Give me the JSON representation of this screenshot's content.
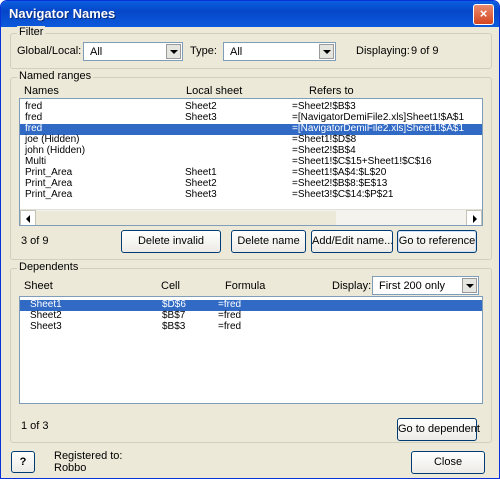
{
  "window": {
    "title": "Navigator Names",
    "close_glyph": "×"
  },
  "filter": {
    "legend": "Filter",
    "global_local_label": "Global/Local:",
    "global_local_value": "All",
    "type_label": "Type:",
    "type_value": "All",
    "displaying_label": "Displaying:",
    "displaying_value": "9 of 9"
  },
  "named_ranges": {
    "legend": "Named ranges",
    "headers": {
      "names": "Names",
      "local_sheet": "Local sheet",
      "refers_to": "Refers to"
    },
    "rows": [
      {
        "name": "fred",
        "local": "Sheet2",
        "ref": "=Sheet2!$B$3"
      },
      {
        "name": "fred",
        "local": "Sheet3",
        "ref": "=[NavigatorDemiFile2.xls]Sheet1!$A$1"
      },
      {
        "name": "fred",
        "local": "",
        "ref": "=[NavigatorDemiFile2.xls]Sheet1!$A$1"
      },
      {
        "name": "joe (Hidden)",
        "local": "",
        "ref": "=Sheet1!$D$8"
      },
      {
        "name": "john (Hidden)",
        "local": "",
        "ref": "=Sheet2!$B$4"
      },
      {
        "name": "Multi",
        "local": "",
        "ref": "=Sheet1!$C$15+Sheet1!$C$16"
      },
      {
        "name": "Print_Area",
        "local": "Sheet1",
        "ref": "=Sheet1!$A$4:$L$20"
      },
      {
        "name": "Print_Area",
        "local": "Sheet2",
        "ref": "=Sheet2!$B$8:$E$13"
      },
      {
        "name": "Print_Area",
        "local": "Sheet3",
        "ref": "=Sheet3!$C$14:$P$21"
      }
    ],
    "selected_index": 2,
    "count_text": "3 of 9",
    "buttons": {
      "delete_invalid": "Delete invalid",
      "delete_name": "Delete name",
      "add_edit": "Add/Edit name...",
      "go_to_reference": "Go to reference"
    }
  },
  "dependents": {
    "legend": "Dependents",
    "headers": {
      "sheet": "Sheet",
      "cell": "Cell",
      "formula": "Formula"
    },
    "display_label": "Display:",
    "display_value": "First 200 only",
    "rows": [
      {
        "sheet": "Sheet1",
        "cell": "$D$6",
        "formula": "=fred"
      },
      {
        "sheet": "Sheet2",
        "cell": "$B$7",
        "formula": "=fred"
      },
      {
        "sheet": "Sheet3",
        "cell": "$B$3",
        "formula": "=fred"
      }
    ],
    "selected_index": 0,
    "count_text": "1 of 3",
    "go_to_dependent": "Go to dependent"
  },
  "footer": {
    "help_glyph": "?",
    "registered_to": "Registered to:",
    "user": "Robbo",
    "close": "Close"
  },
  "colors": {
    "selection": "#316ac5",
    "titlebar": "#0a54d6",
    "face": "#ece9d8"
  }
}
